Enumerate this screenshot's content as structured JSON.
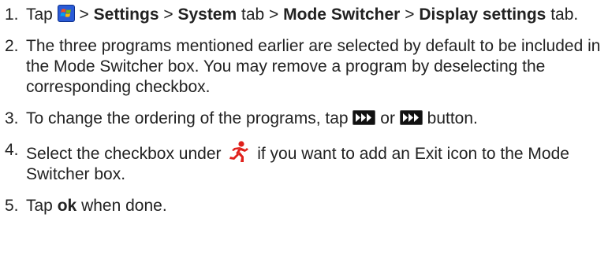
{
  "steps": [
    {
      "number": "1.",
      "parts": {
        "a": "Tap",
        "b": ">",
        "c": "Settings",
        "d": ">",
        "e": "System",
        "f": "tab >",
        "g": "Mode Switcher",
        "h": ">",
        "i": "Display settings",
        "j": "tab."
      }
    },
    {
      "number": "2.",
      "text": "The three programs mentioned earlier are selected by default to be included in the Mode Switcher box. You may remove a program by deselecting the corresponding checkbox."
    },
    {
      "number": "3.",
      "parts": {
        "a": "To change the ordering of the programs, tap",
        "b": "or",
        "c": "button."
      }
    },
    {
      "number": "4.",
      "parts": {
        "a": "Select the checkbox under",
        "b": "if you want to add an Exit icon to the Mode Switcher box."
      }
    },
    {
      "number": "5.",
      "parts": {
        "a": "Tap",
        "b": "ok",
        "c": "when done."
      }
    }
  ],
  "icons": {
    "start": "windows-start-icon",
    "move_button_1": "fast-forward-button-icon",
    "move_button_2": "fast-forward-button-icon",
    "exit": "running-man-exit-icon"
  },
  "colors": {
    "text": "#222222",
    "start_icon_bg": "#2a5bd7",
    "exit_icon": "#e0201b",
    "button_bg": "#111111"
  }
}
